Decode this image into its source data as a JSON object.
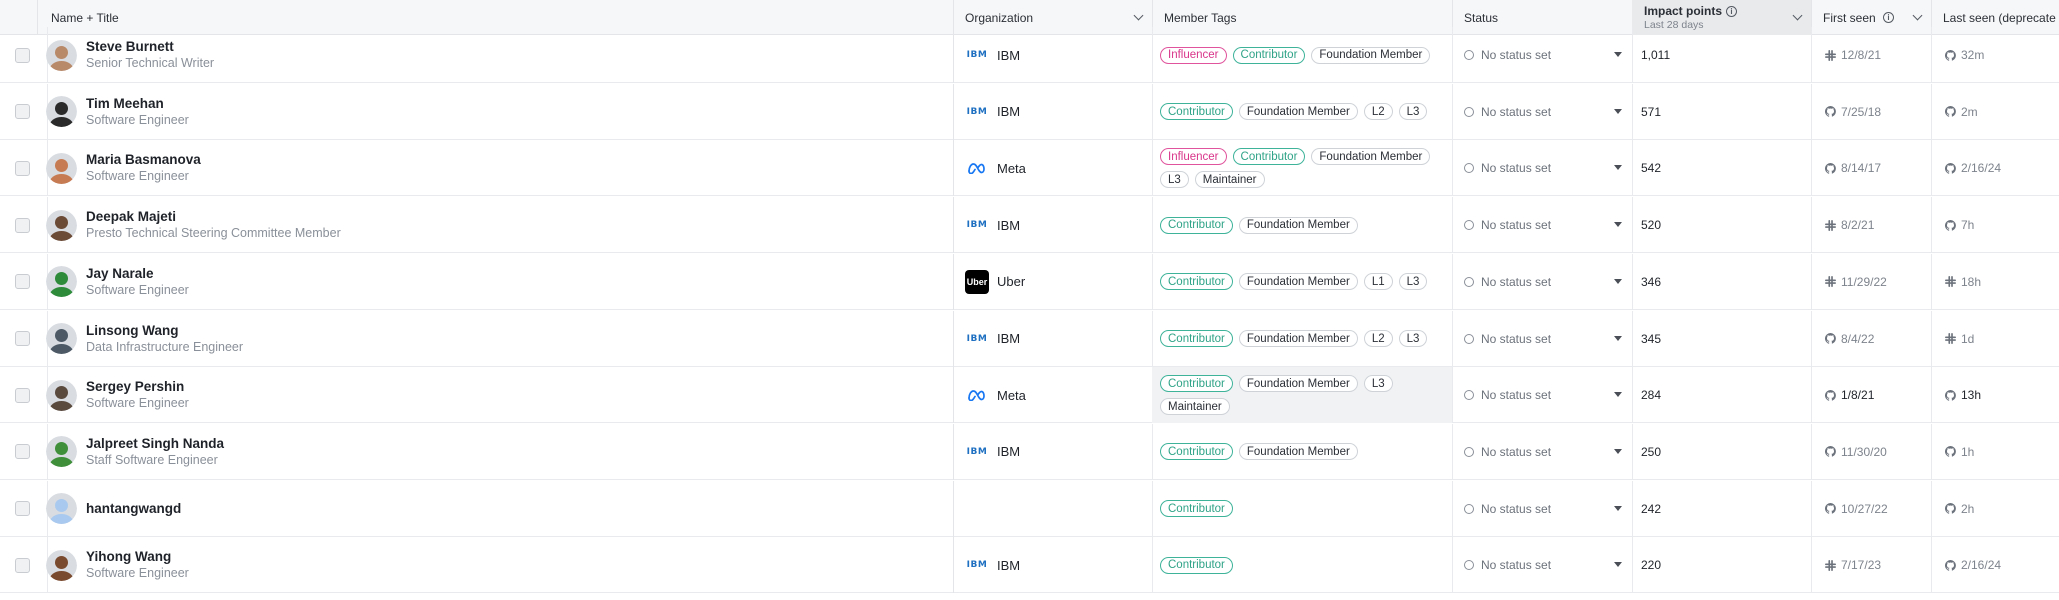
{
  "columns": {
    "name": "Name + Title",
    "organization": "Organization",
    "tags": "Member Tags",
    "status": "Status",
    "impact": "Impact points",
    "impact_sub": "Last 28 days",
    "first_seen": "First seen",
    "last_seen": "Last seen (deprecate"
  },
  "rows": [
    {
      "name": "Steve Burnett",
      "title": "Senior Technical Writer",
      "org": "IBM",
      "org_logo": "ibm-logo",
      "tags": [
        "Influencer",
        "Contributor",
        "Foundation Member"
      ],
      "status": "No status set",
      "impact": "1,011",
      "first_seen": "12/8/21",
      "first_icon": "slack-icon",
      "last_seen": "32m",
      "last_icon": "github-icon",
      "avatar_color": "#b98a6a"
    },
    {
      "name": "Tim Meehan",
      "title": "Software Engineer",
      "org": "IBM",
      "org_logo": "ibm-logo",
      "tags": [
        "Contributor",
        "Foundation Member",
        "L2",
        "L3"
      ],
      "status": "No status set",
      "impact": "571",
      "first_seen": "7/25/18",
      "first_icon": "github-icon",
      "last_seen": "2m",
      "last_icon": "github-icon",
      "avatar_color": "#2a2a2a"
    },
    {
      "name": "Maria Basmanova",
      "title": "Software Engineer",
      "org": "Meta",
      "org_logo": "meta-logo",
      "tags": [
        "Influencer",
        "Contributor",
        "Foundation Member",
        "L3",
        "Maintainer"
      ],
      "status": "No status set",
      "impact": "542",
      "first_seen": "8/14/17",
      "first_icon": "github-icon",
      "last_seen": "2/16/24",
      "last_icon": "github-icon",
      "avatar_color": "#c77b52"
    },
    {
      "name": "Deepak Majeti",
      "title": "Presto Technical Steering Committee Member",
      "org": "IBM",
      "org_logo": "ibm-logo",
      "tags": [
        "Contributor",
        "Foundation Member"
      ],
      "status": "No status set",
      "impact": "520",
      "first_seen": "8/2/21",
      "first_icon": "slack-icon",
      "last_seen": "7h",
      "last_icon": "github-icon",
      "avatar_color": "#6b4a36"
    },
    {
      "name": "Jay Narale",
      "title": "Software Engineer",
      "org": "Uber",
      "org_logo": "uber-logo",
      "tags": [
        "Contributor",
        "Foundation Member",
        "L1",
        "L3"
      ],
      "status": "No status set",
      "impact": "346",
      "first_seen": "11/29/22",
      "first_icon": "slack-icon",
      "last_seen": "18h",
      "last_icon": "slack-icon",
      "avatar_color": "#2e8b3a"
    },
    {
      "name": "Linsong Wang",
      "title": "Data Infrastructure Engineer",
      "org": "IBM",
      "org_logo": "ibm-logo",
      "tags": [
        "Contributor",
        "Foundation Member",
        "L2",
        "L3"
      ],
      "status": "No status set",
      "impact": "345",
      "first_seen": "8/4/22",
      "first_icon": "github-icon",
      "last_seen": "1d",
      "last_icon": "slack-icon",
      "avatar_color": "#4d5a66"
    },
    {
      "name": "Sergey Pershin",
      "title": "Software Engineer",
      "org": "Meta",
      "org_logo": "meta-logo",
      "tags": [
        "Contributor",
        "Foundation Member",
        "L3",
        "Maintainer"
      ],
      "status": "No status set",
      "impact": "284",
      "first_seen": "1/8/21",
      "first_icon": "github-icon",
      "last_seen": "13h",
      "last_icon": "github-icon",
      "avatar_color": "#5a4a3e",
      "highlight": true
    },
    {
      "name": "Jalpreet Singh Nanda",
      "title": "Staff Software Engineer",
      "org": "IBM",
      "org_logo": "ibm-logo",
      "tags": [
        "Contributor",
        "Foundation Member"
      ],
      "status": "No status set",
      "impact": "250",
      "first_seen": "11/30/20",
      "first_icon": "github-icon",
      "last_seen": "1h",
      "last_icon": "github-icon",
      "avatar_color": "#3f8f3a"
    },
    {
      "name": "hantangwangd",
      "title": "",
      "org": "",
      "org_logo": "",
      "tags": [
        "Contributor"
      ],
      "status": "No status set",
      "impact": "242",
      "first_seen": "10/27/22",
      "first_icon": "github-icon",
      "last_seen": "2h",
      "last_icon": "github-icon",
      "avatar_color": "#a9c9ee"
    },
    {
      "name": "Yihong Wang",
      "title": "Software Engineer",
      "org": "IBM",
      "org_logo": "ibm-logo",
      "tags": [
        "Contributor"
      ],
      "status": "No status set",
      "impact": "220",
      "first_seen": "7/17/23",
      "first_icon": "slack-icon",
      "last_seen": "2/16/24",
      "last_icon": "github-icon",
      "avatar_color": "#7a4a2e"
    }
  ]
}
